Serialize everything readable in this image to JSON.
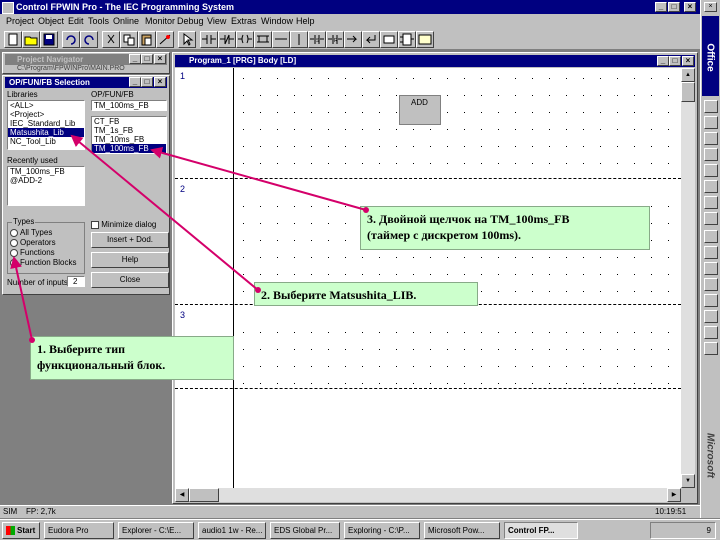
{
  "window": {
    "title": "Control FPWIN Pro - The IEC Programming System"
  },
  "menu": [
    "Project",
    "Object",
    "Edit",
    "Tools",
    "Online",
    "Monitor",
    "Debug",
    "View",
    "Extras",
    "Window",
    "Help"
  ],
  "office_bar": {
    "label": "Office",
    "vertical_label": "Microsoft"
  },
  "navigator": {
    "title": "Project Navigator",
    "path": "C:\\Program\\FPWINPro\\MAIN.PRO"
  },
  "selection": {
    "title": "OP/FUN/FB Selection",
    "libraries_label": "Libraries",
    "libraries": [
      "<ALL>",
      "<Project>",
      "IEC_Standard_Lib",
      "Matsushita_Lib",
      "NC_Tool_Lib"
    ],
    "selected_library_index": 3,
    "opfunfb_label": "OP/FUN/FB",
    "opfunfb_field": "TM_100ms_FB",
    "opfunfb": [
      "CT_FB",
      "TM_1s_FB",
      "TM_10ms_FB",
      "TM_100ms_FB"
    ],
    "selected_opfunfb_index": 3,
    "recently_used_label": "Recently used",
    "recently_used": [
      "TM_100ms_FB",
      "@ADD-2"
    ],
    "types_label": "Types",
    "types": [
      "All Types",
      "Operators",
      "Functions",
      "Function Blocks"
    ],
    "selected_type_index": 3,
    "minimize_label": "Minimize dialog",
    "insert_button": "Insert + Dod.",
    "help_button": "Help",
    "close_button": "Close",
    "inputs_label": "Number of inputs:",
    "inputs_value": "2"
  },
  "editor": {
    "title": "Program_1 [PRG] Body [LD]",
    "rows": [
      "1",
      "2",
      "3"
    ],
    "block_label": "ADD"
  },
  "callouts": {
    "step1": "1. Выберите тип\nфункциональный блок.",
    "step2": "2. Выберите Matsushita_LIB.",
    "step3": "3. Двойной щелчок на TM_100ms_FB\n(таймер с дискретом 100ms)."
  },
  "status": {
    "mode": "SIM",
    "plc": "FP: 2,7k",
    "time": "10:19:51"
  },
  "taskbar": {
    "start": "Start",
    "items": [
      "Eudora Pro",
      "Explorer - C:\\E...",
      "audio1 1w - Re...",
      "EDS Global Pr...",
      "Exploring - C:\\P...",
      "Microsoft Pow...",
      "Control FP..."
    ],
    "clock": "9"
  },
  "colors": {
    "title_active": "#000080",
    "callout_bg": "#ccffcc",
    "arrow": "#d4006a",
    "face": "#c0c0c0"
  }
}
